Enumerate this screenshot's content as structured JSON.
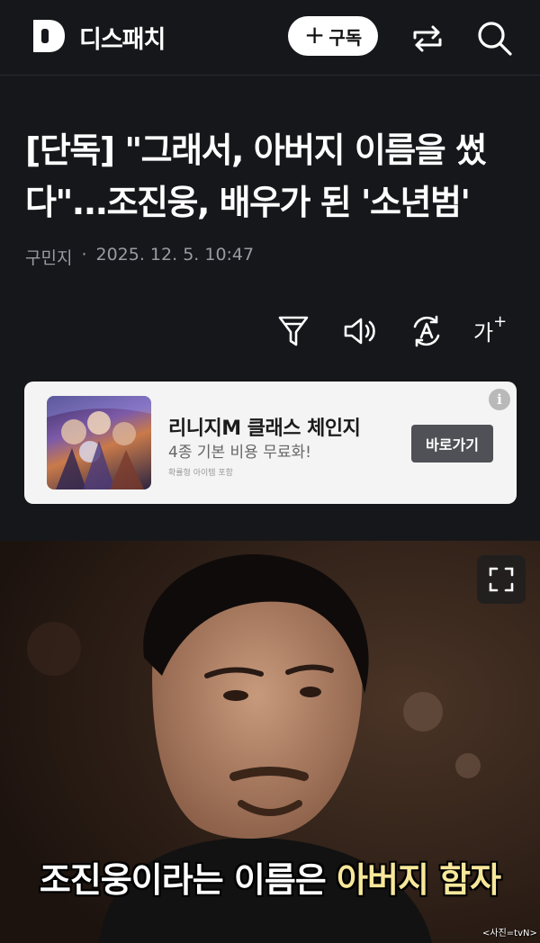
{
  "header": {
    "brand": "디스패치",
    "subscribe_label": "구독",
    "icons": [
      "dispatch-logo-icon",
      "share-icon",
      "search-icon"
    ]
  },
  "article": {
    "headline": "[단독] \"그래서, 아버지 이름을 썼다\"...조진웅, 배우가 된 '소년범'",
    "author": "구민지",
    "separator": "·",
    "datetime": "2025. 12. 5. 10:47"
  },
  "toolbar": {
    "icons": [
      "filter-icon",
      "speaker-icon",
      "translate-icon",
      "font-size-icon"
    ],
    "font_size_label": "가",
    "font_size_sup": "+"
  },
  "ad": {
    "title": "리니지M 클래스 체인지",
    "description": "4종 기본 비용 무료화!",
    "note": "확률형 아이템 포함",
    "button_label": "바로가기",
    "info_label": "i"
  },
  "photo": {
    "subtitle_part1": "조진웅이라는 이름은",
    "subtitle_part2": "아버지 함자",
    "credit": "<사진=tvN>"
  },
  "colors": {
    "background": "#16171b",
    "subtitle_highlight": "#f7e79a",
    "ad_button": "#505156"
  }
}
